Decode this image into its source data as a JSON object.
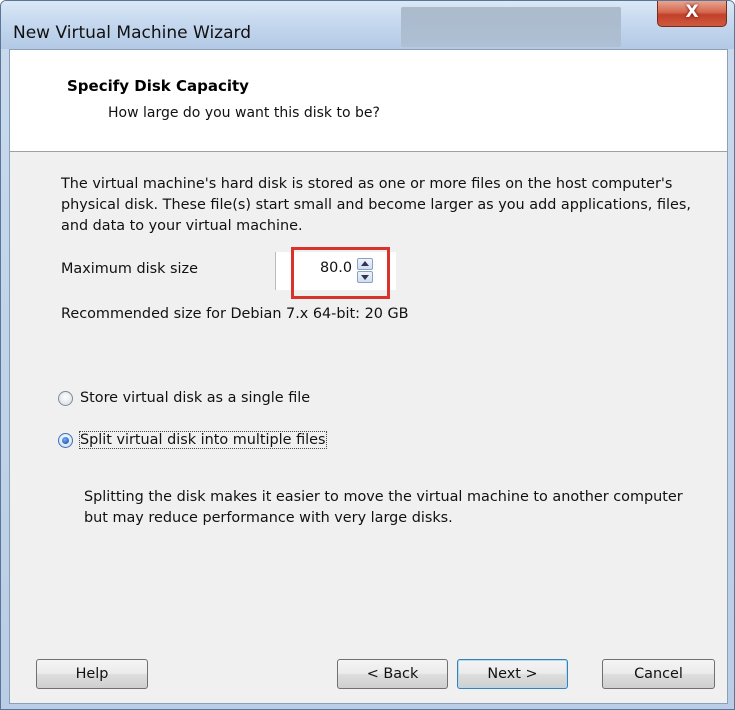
{
  "window": {
    "title": "New Virtual Machine Wizard",
    "close_glyph": "X"
  },
  "header": {
    "title": "Specify Disk Capacity",
    "subtitle": "How large do you want this disk to be?"
  },
  "intro": "The virtual machine's hard disk is stored as one or more files on the host computer's physical disk. These file(s) start small and become larger as you add applications, files, and data to your virtual machine.",
  "disk_size": {
    "label": "Maximum disk size",
    "value": "80.0"
  },
  "recommendation": "Recommended size for Debian 7.x 64-bit: 20 GB",
  "options": [
    {
      "label": "Store virtual disk as a single file",
      "selected": false
    },
    {
      "label": "Split virtual disk into multiple files",
      "selected": true
    }
  ],
  "split_description": "Splitting the disk makes it easier to move the virtual machine to another computer but may reduce performance with very large disks.",
  "buttons": {
    "help": "Help",
    "back": "< Back",
    "next": "Next >",
    "cancel": "Cancel"
  },
  "colors": {
    "highlight": "#d9342b",
    "close": "#c2402a",
    "frame": "#b9cde6"
  }
}
